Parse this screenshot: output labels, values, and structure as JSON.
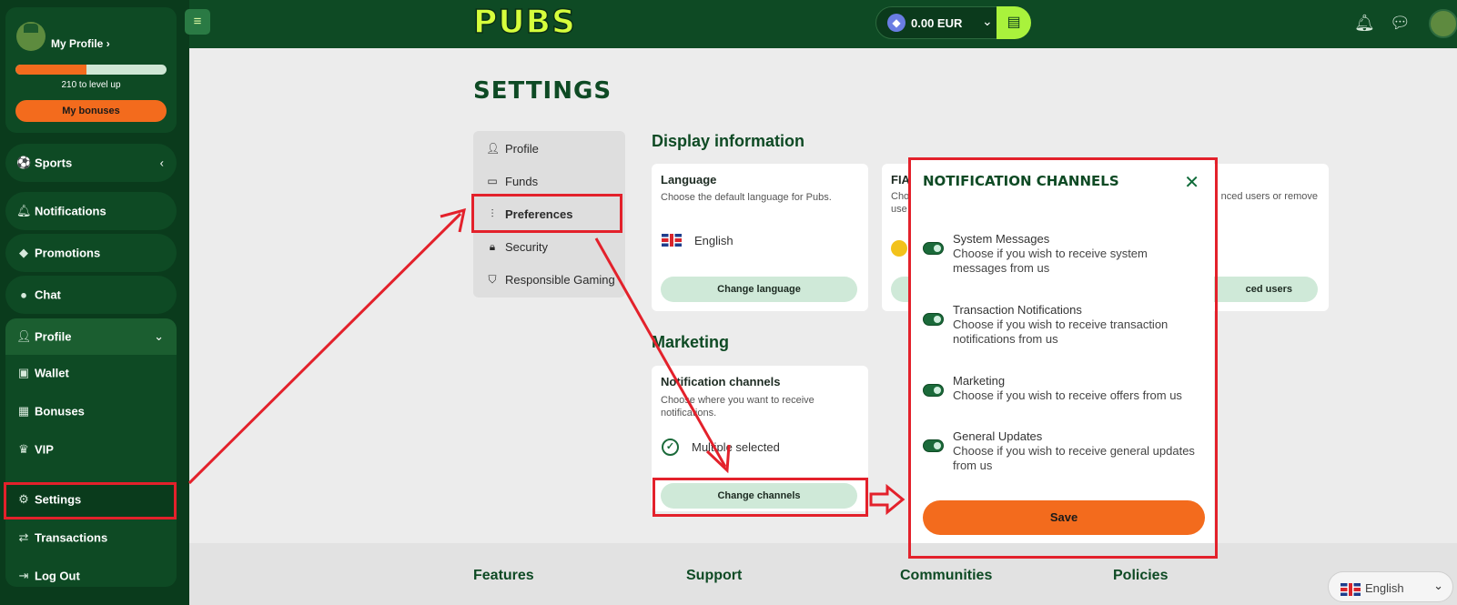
{
  "brand": {
    "logo": "PUBS"
  },
  "topbar": {
    "balance": "0.00 EUR",
    "icons": [
      "menu-icon",
      "ethereum-icon",
      "chevron-down-icon",
      "wallet-icon",
      "bell-icon",
      "chat-icon",
      "avatar"
    ]
  },
  "sidebar": {
    "profile_link": "My Profile",
    "level_progress": 0.47,
    "level_text": "210 to level up",
    "bonuses_button": "My bonuses",
    "items": [
      {
        "label": "Sports",
        "icon": "sports-icon"
      },
      {
        "label": "Notifications",
        "icon": "bell-icon"
      },
      {
        "label": "Promotions",
        "icon": "tag-icon"
      },
      {
        "label": "Chat",
        "icon": "chat-icon"
      },
      {
        "label": "Profile",
        "icon": "user-icon"
      },
      {
        "label": "Wallet",
        "icon": "wallet-icon"
      },
      {
        "label": "Bonuses",
        "icon": "gift-icon"
      },
      {
        "label": "VIP",
        "icon": "crown-icon"
      },
      {
        "label": "Settings",
        "icon": "gear-icon"
      },
      {
        "label": "Transactions",
        "icon": "transactions-icon"
      },
      {
        "label": "Log Out",
        "icon": "logout-icon"
      }
    ]
  },
  "settings": {
    "title": "SETTINGS",
    "nav": [
      {
        "label": "Profile",
        "icon": "user-icon"
      },
      {
        "label": "Funds",
        "icon": "money-icon"
      },
      {
        "label": "Preferences",
        "icon": "sliders-icon"
      },
      {
        "label": "Security",
        "icon": "lock-icon"
      },
      {
        "label": "Responsible Gaming",
        "icon": "shield-icon"
      }
    ],
    "display_section": "Display information",
    "language_card": {
      "title": "Language",
      "subtitle": "Choose the default language for Pubs.",
      "value": "English",
      "button": "Change language"
    },
    "fiat_card": {
      "title_fragment": "FIA",
      "subtitle_fragment_left": "Cho",
      "subtitle_fragment_left2": "use",
      "subtitle_fragment_right": "nced users or remove",
      "button_fragment": "ced users"
    },
    "marketing_section": "Marketing",
    "channels_card": {
      "title": "Notification channels",
      "subtitle": "Choose where you want to receive notifications.",
      "value": "Multiple selected",
      "button": "Change channels"
    }
  },
  "modal": {
    "title": "NOTIFICATION CHANNELS",
    "rows": [
      {
        "title": "System Messages",
        "desc": "Choose if you wish to receive system messages from us"
      },
      {
        "title": "Transaction Notifications",
        "desc": "Choose if you wish to receive transaction notifications from us"
      },
      {
        "title": "Marketing",
        "desc": "Choose if you wish to receive offers from us"
      },
      {
        "title": "General Updates",
        "desc": "Choose if you wish to receive general updates from us"
      }
    ],
    "save": "Save"
  },
  "footer": {
    "columns": [
      "Features",
      "Support",
      "Communities",
      "Policies"
    ],
    "language": "English"
  },
  "colors": {
    "brand_green": "#0e4a24",
    "accent_orange": "#f36b1d",
    "lime": "#a9f23c",
    "annotation_red": "#e3212b"
  }
}
